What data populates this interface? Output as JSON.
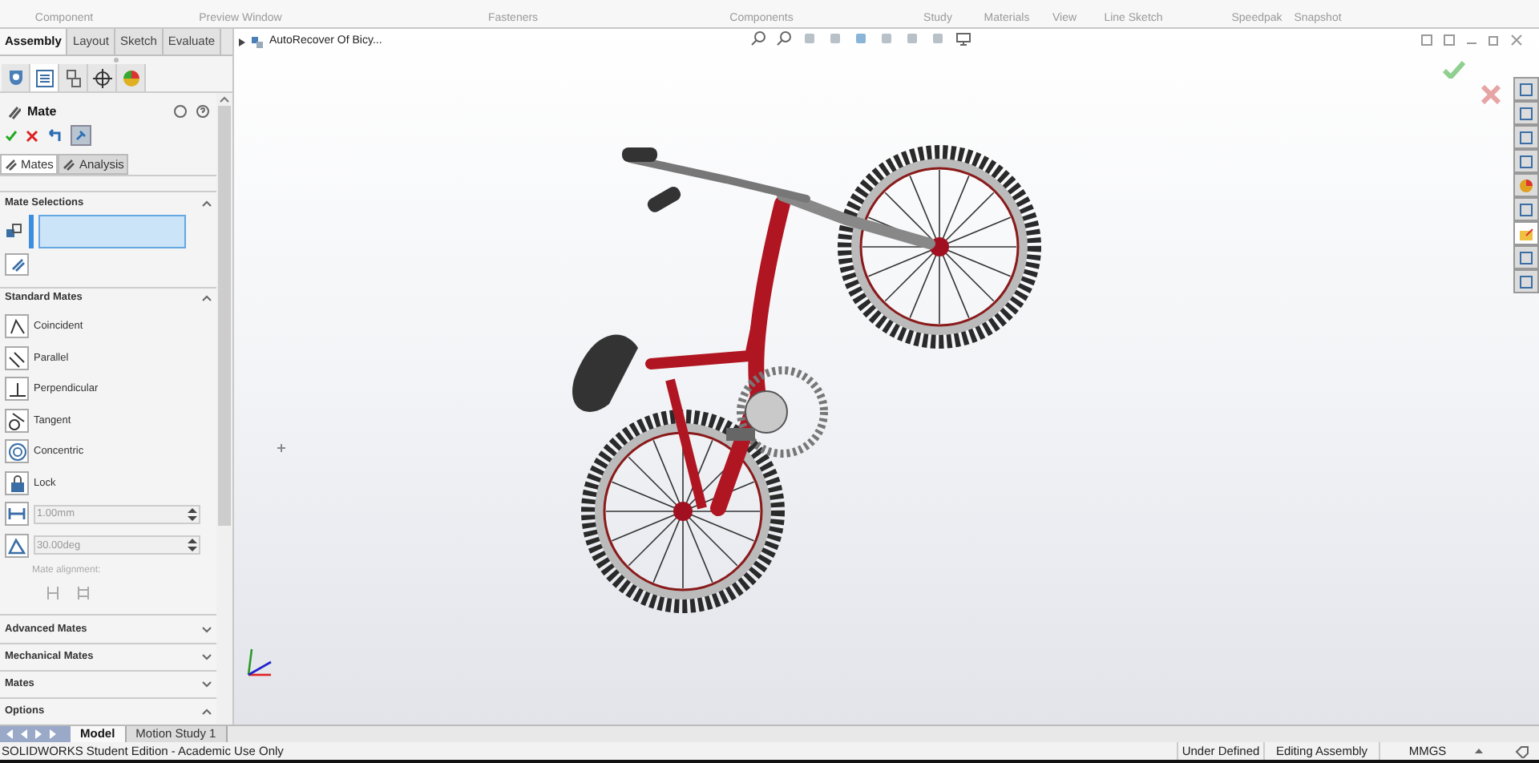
{
  "ribbon": {
    "buttons": [
      "Component",
      "Preview Window",
      "Fasteners",
      "Components",
      "Study",
      "Materials",
      "View",
      "Line Sketch",
      "Speedpak",
      "Snapshot"
    ]
  },
  "command_tabs": [
    {
      "label": "Assembly",
      "selected": true
    },
    {
      "label": "Layout",
      "selected": false
    },
    {
      "label": "Sketch",
      "selected": false
    },
    {
      "label": "Evaluate",
      "selected": false
    }
  ],
  "manager_tabs": [
    {
      "selected": false
    },
    {
      "selected": true
    },
    {
      "selected": false
    },
    {
      "selected": false
    },
    {
      "selected": false
    }
  ],
  "feature_tree": {
    "item": "AutoRecover Of Bicy..."
  },
  "task_pane_tabs": [
    {
      "selected": false
    },
    {
      "selected": false
    },
    {
      "selected": false
    },
    {
      "selected": false
    },
    {
      "selected": false
    },
    {
      "selected": false
    },
    {
      "selected": true
    },
    {
      "selected": false
    },
    {
      "selected": false
    }
  ],
  "property_manager": {
    "title": "Mate",
    "tabs": [
      {
        "label": "Mates",
        "selected": true
      },
      {
        "label": "Analysis",
        "selected": false
      }
    ],
    "mate_selections": {
      "title": "Mate Selections",
      "expanded": true
    },
    "standard_mates": {
      "title": "Standard Mates",
      "expanded": true,
      "items": [
        {
          "kind": "mate",
          "label": "Coincident"
        },
        {
          "kind": "mate",
          "label": "Parallel"
        },
        {
          "kind": "mate",
          "label": "Perpendicular"
        },
        {
          "kind": "mate",
          "label": "Tangent"
        },
        {
          "kind": "mate",
          "label": "Concentric"
        },
        {
          "kind": "mate",
          "label": "Lock"
        },
        {
          "kind": "field",
          "value": "1.00mm",
          "disabled": true
        },
        {
          "kind": "field",
          "value": "30.00deg",
          "disabled": true
        }
      ],
      "alignment_label": "Mate alignment:"
    },
    "collapsed_sections": [
      {
        "title": "Advanced Mates",
        "expanded": false
      },
      {
        "title": "Mechanical Mates",
        "expanded": false
      },
      {
        "title": "Mates",
        "expanded": false
      },
      {
        "title": "Options",
        "expanded": true
      }
    ]
  },
  "bottom_tabs": [
    {
      "label": "Model",
      "selected": true
    },
    {
      "label": "Motion Study 1",
      "selected": false
    }
  ],
  "status_bar": {
    "product": "SOLIDWORKS Student Edition - Academic Use Only",
    "items": [
      "Under Defined",
      "Editing Assembly",
      "MMGS"
    ]
  }
}
